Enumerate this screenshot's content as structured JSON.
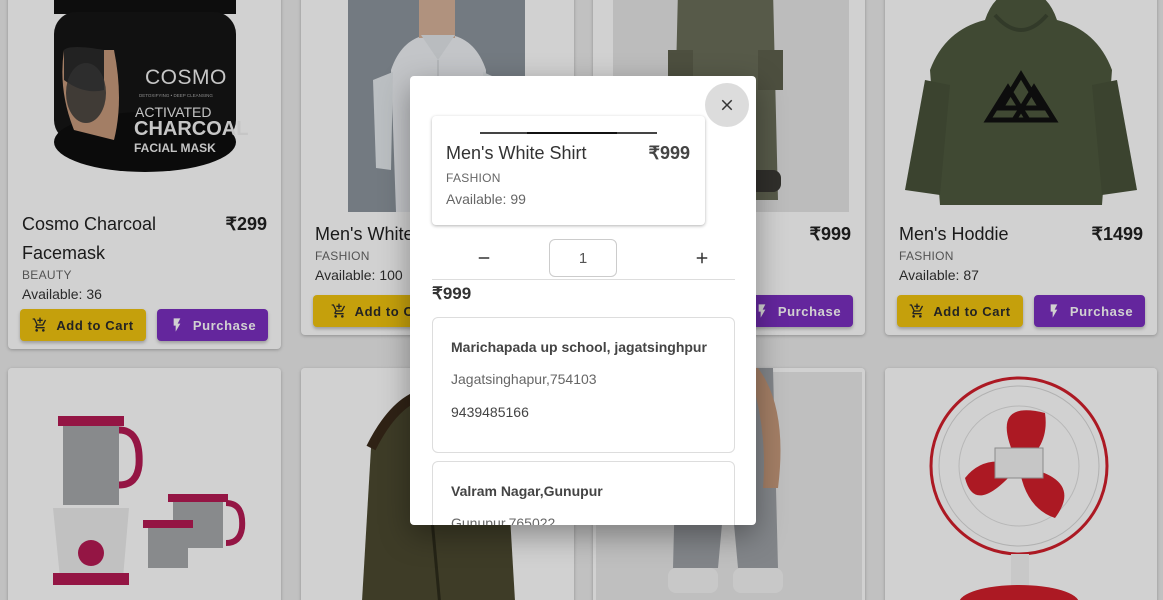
{
  "products": [
    {
      "name_line1": "Cosmo Charcoal",
      "name_line2": "Facemask",
      "price": "₹299",
      "category": "BEAUTY",
      "availability": "Available: 36",
      "cart_label": "Add to Cart",
      "buy_label": "Purchase",
      "image_text": {
        "brand": "COSMO",
        "tagline": "DETOXIFYING • DEEP CLEANSING",
        "line1": "ACTIVATED",
        "line2": "CHARCOAL",
        "line3": "FACIAL MASK"
      }
    },
    {
      "name": "Men's White",
      "category": "FASHION",
      "availability": "Available: 100",
      "cart_label": "Add to Ca"
    },
    {
      "price": "₹999",
      "buy_label": "Purchase"
    },
    {
      "name": "Men's Hoddie",
      "price": "₹1499",
      "category": "FASHION",
      "availability": "Available: 87",
      "cart_label": "Add to Cart",
      "buy_label": "Purchase"
    }
  ],
  "modal": {
    "product_name": "Men's White Shirt",
    "product_price": "₹999",
    "product_category": "FASHION",
    "product_availability": "Available: 99",
    "quantity": "1",
    "total": "₹999",
    "addresses": [
      {
        "line1": "Marichapada up school, jagatsinghpur",
        "line2": "Jagatsinghapur,754103",
        "phone": "9439485166"
      },
      {
        "line1": "Valram Nagar,Gunupur",
        "line2": "Gunupur,765022"
      }
    ]
  },
  "colors": {
    "cart_button": "#f1c40f",
    "purchase_button": "#7b2fc0",
    "hoodie": "#4f5a3f",
    "fan_red": "#d21f2b",
    "mixer_pink": "#b51a53"
  },
  "icons": [
    "cart-plus-icon",
    "bolt-icon",
    "close-icon",
    "minus-icon",
    "plus-icon"
  ]
}
